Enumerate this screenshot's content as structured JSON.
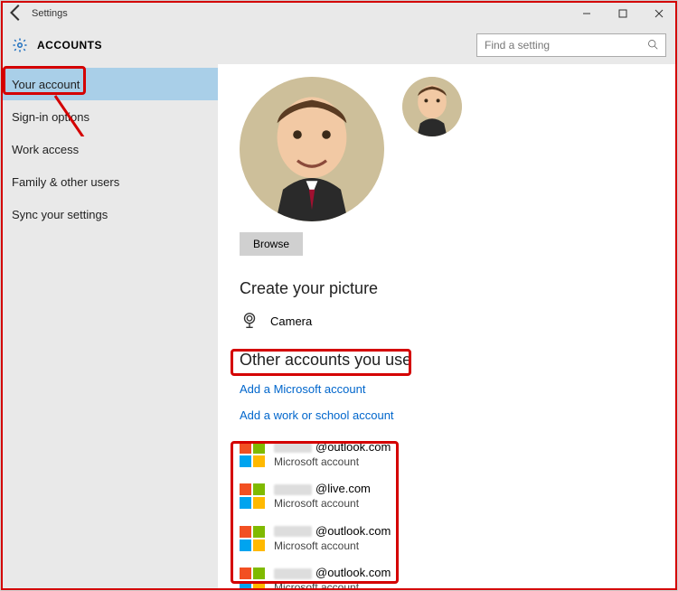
{
  "window": {
    "title": "Settings"
  },
  "header": {
    "title": "ACCOUNTS",
    "search_placeholder": "Find a setting"
  },
  "sidebar": {
    "items": [
      {
        "label": "Your account",
        "active": true
      },
      {
        "label": "Sign-in options"
      },
      {
        "label": "Work access"
      },
      {
        "label": "Family & other users"
      },
      {
        "label": "Sync your settings"
      }
    ]
  },
  "content": {
    "browse_label": "Browse",
    "create_picture_title": "Create your picture",
    "camera_label": "Camera",
    "other_accounts_title": "Other accounts you use",
    "add_ms_link": "Add a Microsoft account",
    "add_work_link": "Add a work or school account",
    "accounts": [
      {
        "domain": "@outlook.com",
        "type": "Microsoft account"
      },
      {
        "domain": "@live.com",
        "type": "Microsoft account"
      },
      {
        "domain": "@outlook.com",
        "type": "Microsoft account"
      },
      {
        "domain": "@outlook.com",
        "type": "Microsoft account"
      }
    ]
  }
}
